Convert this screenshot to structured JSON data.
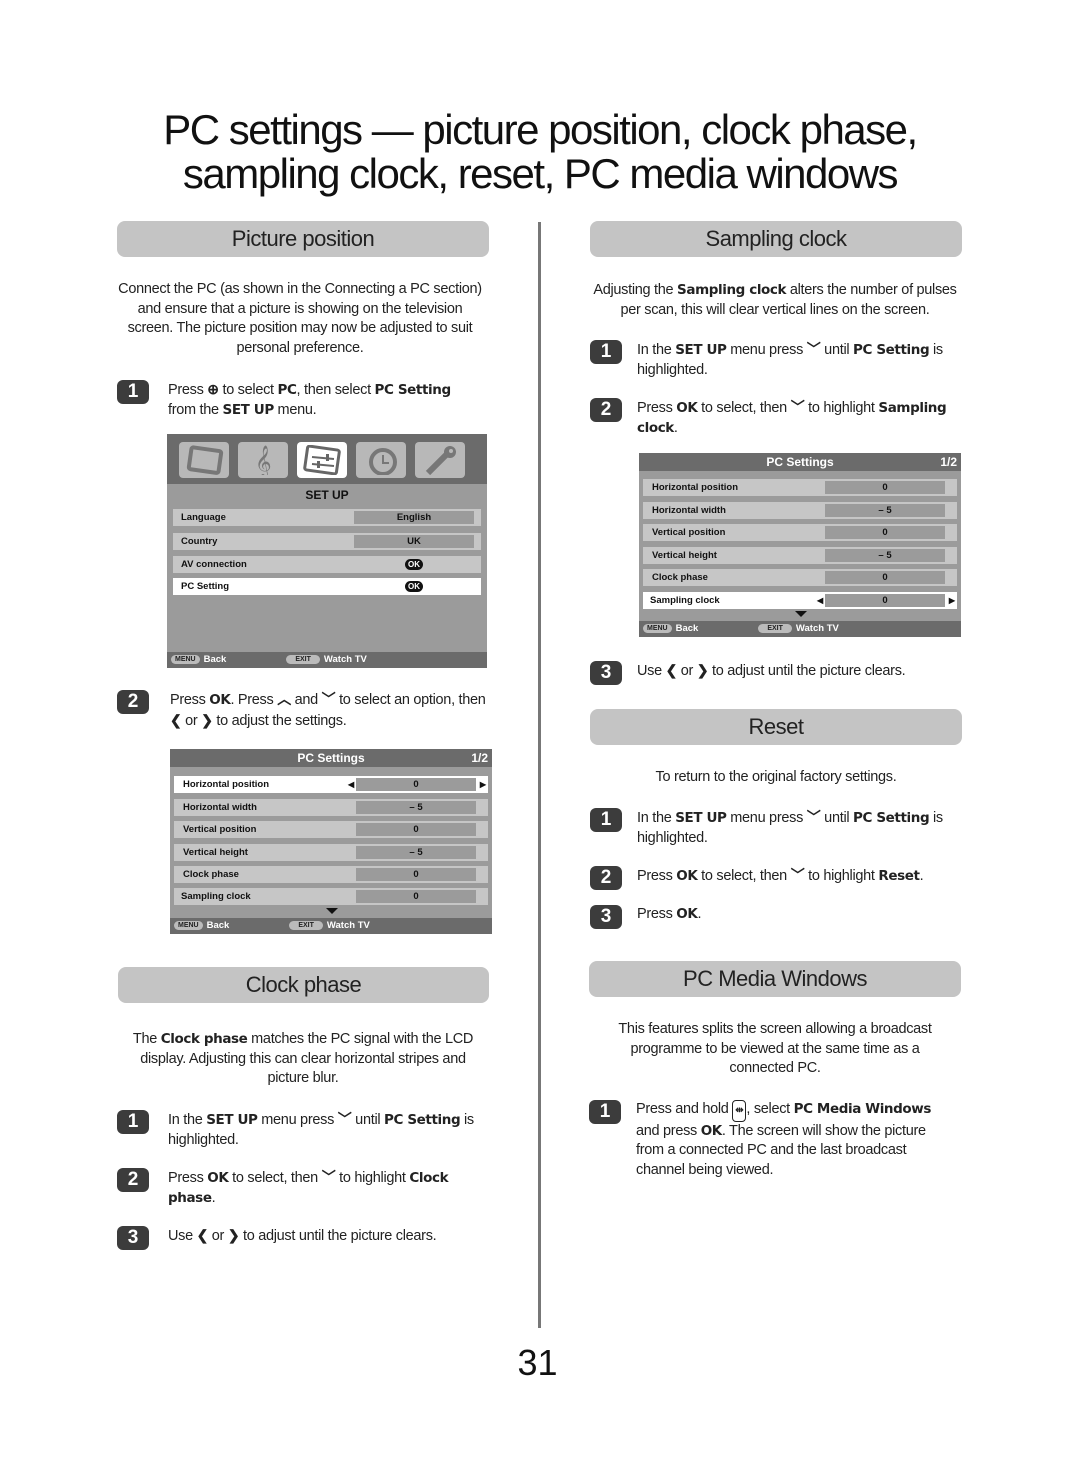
{
  "page": {
    "title_line1": "PC settings — picture position, clock phase,",
    "title_line2": "sampling clock, reset, PC media windows",
    "page_number": "31"
  },
  "picture_position": {
    "heading": "Picture position",
    "intro": "Connect the PC (as shown in the  Connecting a PC section) and ensure that a picture is showing on the television screen. The picture position may now be adjusted to suit personal preference.",
    "steps": [
      {
        "num": "1",
        "parts": [
          "Press ",
          " to select ",
          "PC",
          ", then select ",
          "PC Setting",
          " from the ",
          "SET UP",
          " menu."
        ]
      },
      {
        "num": "2",
        "parts": [
          "Press ",
          "OK",
          ". Press ",
          " and ",
          " to select an option, then ",
          " or ",
          " to adjust the settings."
        ]
      }
    ],
    "setup_menu": {
      "icons": [
        "tv-icon",
        "music-icon",
        "setup-sliders-icon",
        "timer-icon",
        "wrench-icon"
      ],
      "active_icon": 2,
      "title": "SET UP",
      "rows": [
        {
          "label": "Language",
          "value": "English"
        },
        {
          "label": "Country",
          "value": "UK"
        },
        {
          "label": "AV connection",
          "value": "OK"
        },
        {
          "label": "PC Setting",
          "value": "OK"
        }
      ],
      "selected_row": 3,
      "footer": {
        "menu_key": "MENU",
        "back": "Back",
        "exit_key": "EXIT",
        "watch": "Watch TV"
      }
    },
    "pc_settings_menu": {
      "title": "PC Settings",
      "page": "1/2",
      "rows": [
        {
          "label": "Horizontal position",
          "value": "0"
        },
        {
          "label": "Horizontal width",
          "value": "– 5"
        },
        {
          "label": "Vertical position",
          "value": "0"
        },
        {
          "label": "Vertical height",
          "value": "– 5"
        },
        {
          "label": "Clock phase",
          "value": "0"
        },
        {
          "label": "Sampling clock",
          "value": "0"
        }
      ],
      "selected_row": 0,
      "footer": {
        "menu_key": "MENU",
        "back": "Back",
        "exit_key": "EXIT",
        "watch": "Watch TV"
      }
    }
  },
  "clock_phase": {
    "heading": "Clock phase",
    "intro_parts": [
      "The ",
      "Clock phase",
      " matches the PC signal with the LCD display. Adjusting this can clear horizontal stripes and picture blur."
    ],
    "steps": [
      {
        "num": "1",
        "parts": [
          "In the ",
          "SET UP",
          " menu press ",
          " until ",
          "PC Setting",
          " is highlighted."
        ]
      },
      {
        "num": "2",
        "parts": [
          "Press ",
          "OK",
          " to select, then ",
          " to highlight ",
          "Clock phase",
          "."
        ]
      },
      {
        "num": "3",
        "parts": [
          "Use ",
          " or ",
          " to adjust until the picture clears."
        ]
      }
    ]
  },
  "sampling_clock": {
    "heading": "Sampling clock",
    "intro_parts": [
      "Adjusting the ",
      "Sampling clock",
      " alters the number of pulses per scan, this will clear vertical lines on the screen."
    ],
    "steps": [
      {
        "num": "1",
        "parts": [
          "In the ",
          "SET UP",
          " menu press ",
          " until ",
          "PC Setting",
          " is highlighted."
        ]
      },
      {
        "num": "2",
        "parts": [
          "Press ",
          "OK",
          " to select, then ",
          " to highlight ",
          "Sampling clock",
          "."
        ]
      },
      {
        "num": "3",
        "parts": [
          "Use ",
          " or ",
          " to adjust until the picture clears."
        ]
      }
    ],
    "pc_settings_menu": {
      "title": "PC Settings",
      "page": "1/2",
      "rows": [
        {
          "label": "Horizontal position",
          "value": "0"
        },
        {
          "label": "Horizontal width",
          "value": "– 5"
        },
        {
          "label": "Vertical position",
          "value": "0"
        },
        {
          "label": "Vertical height",
          "value": "– 5"
        },
        {
          "label": "Clock phase",
          "value": "0"
        },
        {
          "label": "Sampling clock",
          "value": "0"
        }
      ],
      "selected_row": 5,
      "footer": {
        "menu_key": "MENU",
        "back": "Back",
        "exit_key": "EXIT",
        "watch": "Watch TV"
      }
    }
  },
  "reset": {
    "heading": "Reset",
    "intro": "To return to the original factory settings.",
    "steps": [
      {
        "num": "1",
        "parts": [
          "In the ",
          "SET UP",
          " menu press ",
          " until ",
          "PC Setting",
          " is highlighted."
        ]
      },
      {
        "num": "2",
        "parts": [
          "Press ",
          "OK",
          " to select, then ",
          " to highlight ",
          "Reset",
          "."
        ]
      },
      {
        "num": "3",
        "parts": [
          "Press ",
          "OK",
          "."
        ]
      }
    ]
  },
  "pc_media_windows": {
    "heading": "PC Media Windows",
    "intro": "This features splits the screen allowing a broadcast programme to be viewed at the same time as a connected PC.",
    "steps": [
      {
        "num": "1",
        "parts": [
          "Press and hold ",
          ", select ",
          "PC Media Windows",
          " and press ",
          "OK",
          ". The screen will show the picture from a connected PC and the last broadcast channel being viewed."
        ]
      }
    ]
  },
  "colors": {
    "section_header_bg": "#c4c4c4",
    "badge_bg": "#3c3c3c",
    "osd_dark": "#6b6b6b",
    "osd_mid": "#9b9b9b",
    "osd_row": "#c6c6c6",
    "divider": "#777777"
  }
}
